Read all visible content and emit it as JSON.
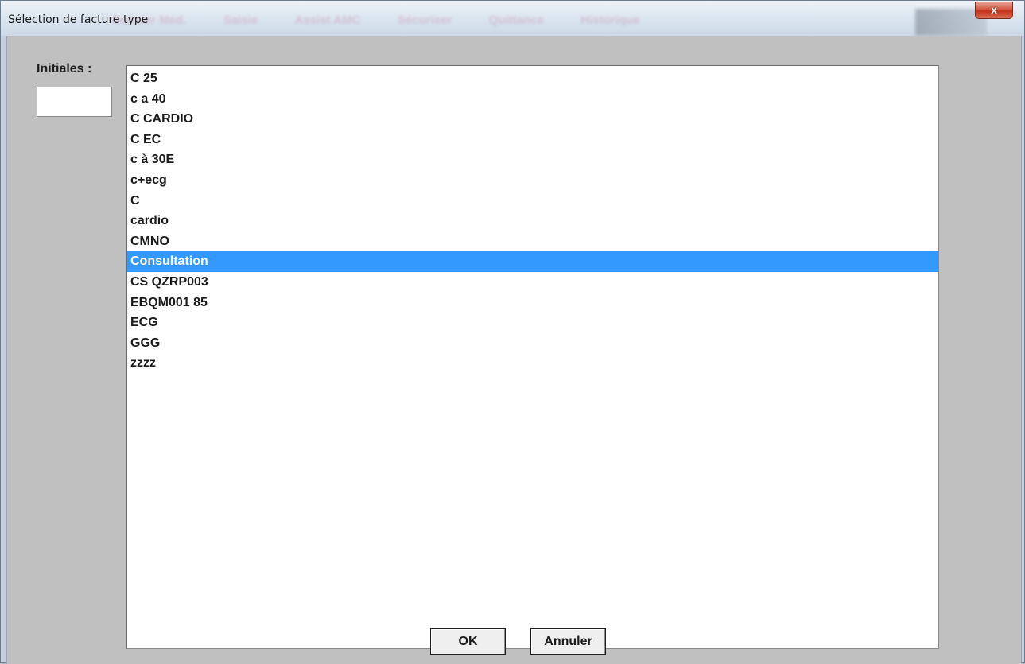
{
  "window": {
    "title": "Sélection de facture type",
    "close_label": "x",
    "background_menu": [
      "Dossier Med.",
      "Saisie",
      "Assist AMC",
      "Sécuriser",
      "Quittance",
      "Historique"
    ]
  },
  "form": {
    "initials_label": "Initiales :",
    "initials_value": "",
    "list_items": [
      "C 25",
      "c a 40",
      "C CARDIO",
      "C EC",
      "c à 30E",
      "c+ecg",
      "C",
      "cardio",
      "CMNO",
      "Consultation",
      "CS QZRP003",
      "EBQM001 85",
      "ECG",
      "GGG",
      "zzzz"
    ],
    "selected_item": "Consultation"
  },
  "buttons": {
    "ok_label": "OK",
    "cancel_label": "Annuler"
  },
  "colors": {
    "selection": "#3399ff",
    "dialog_bg": "#c0c0c0",
    "close_button": "#c3331d"
  }
}
